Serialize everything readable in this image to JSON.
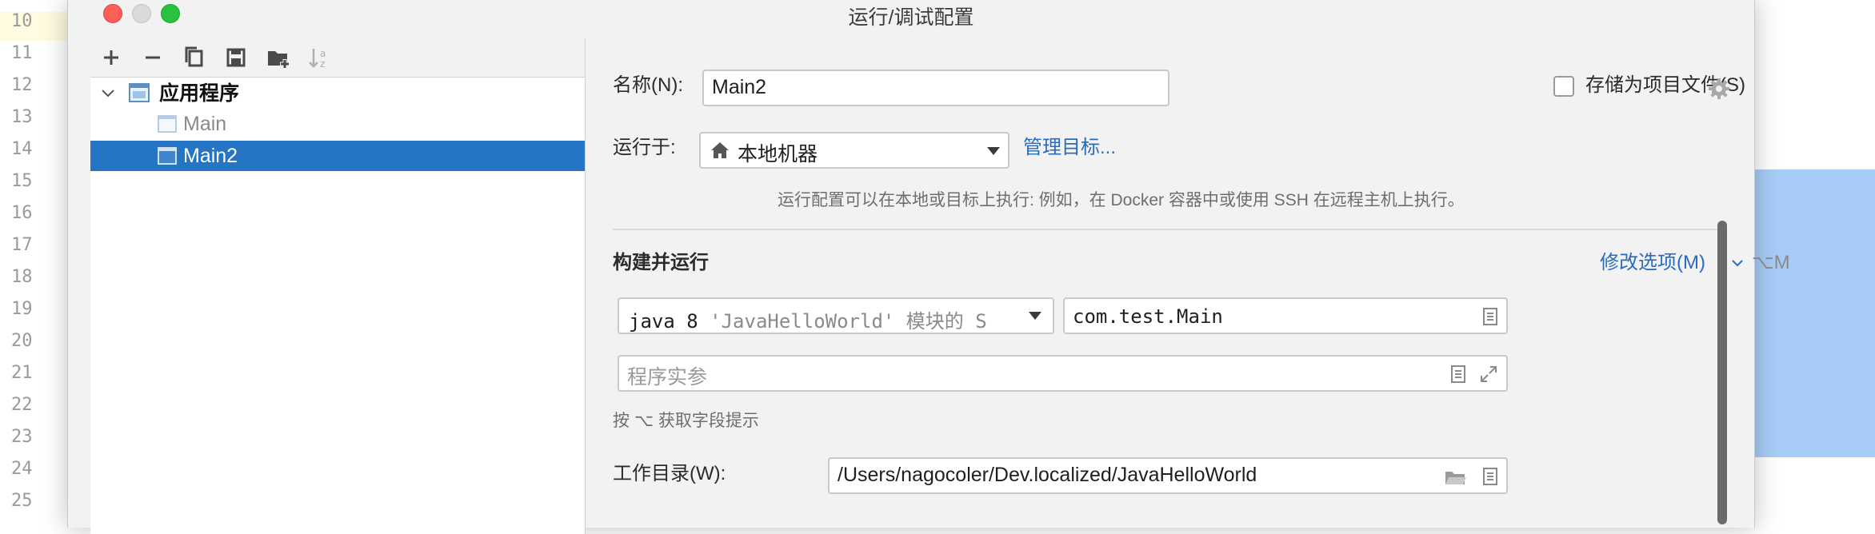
{
  "window": {
    "title": "运行/调试配置"
  },
  "editor_gutter": {
    "line_numbers": [
      "10",
      "11",
      "12",
      "13",
      "14",
      "15",
      "16",
      "17",
      "18",
      "19",
      "20",
      "21",
      "22",
      "23",
      "24",
      "25"
    ]
  },
  "tree": {
    "root_label": "应用程序",
    "items": [
      {
        "label": "Main",
        "selected": false
      },
      {
        "label": "Main2",
        "selected": true
      }
    ]
  },
  "form": {
    "name_label": "名称(N):",
    "name_value": "Main2",
    "store_checkbox_label": "存储为项目文件(S)",
    "store_checked": false,
    "run_on_label": "运行于:",
    "run_on_value": "本地机器",
    "manage_targets_link": "管理目标...",
    "run_on_hint": "运行配置可以在本地或目标上执行: 例如，在 Docker 容器中或使用 SSH 在远程主机上执行。",
    "section_title": "构建并运行",
    "modify_options_link": "修改选项(M)",
    "modify_options_shortcut": "⌥M",
    "jdk_value_prefix": "java 8 ",
    "jdk_value_module": "'JavaHelloWorld' 模块的 S",
    "main_class_value": "com.test.Main",
    "program_args_placeholder": "程序实参",
    "field_hint": "按 ⌥ 获取字段提示",
    "workdir_label": "工作目录(W):",
    "workdir_value": "/Users/nagocoler/Dev.localized/JavaHelloWorld"
  },
  "icons": {
    "add": "plus-icon",
    "remove": "minus-icon",
    "copy": "copy-icon",
    "save": "save-icon",
    "new_folder": "new-folder-icon",
    "sort": "sort-az-icon",
    "gear": "gear-icon",
    "home": "home-icon",
    "dropdown": "chevron-down-icon",
    "doc": "document-icon",
    "expand": "expand-icon",
    "folder": "folder-icon"
  },
  "colors": {
    "selection": "#2675c4",
    "link": "#2a6bbf",
    "close": "#fe5f57",
    "maximize": "#29c140"
  }
}
